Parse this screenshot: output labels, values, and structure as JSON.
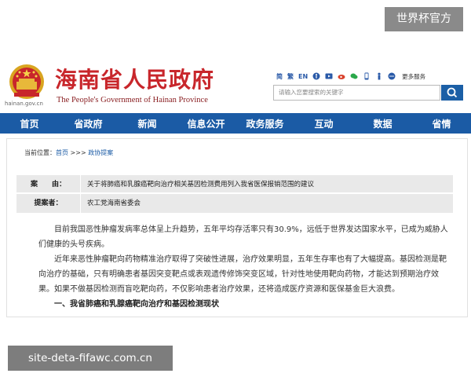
{
  "watermark_top": "世界杯官方",
  "watermark_bottom": "site-deta-fifawc.com.cn",
  "header": {
    "domain": "hainan.gov.cn",
    "title_cn": "海南省人民政府",
    "title_en": "The People's Government of Hainan Province",
    "toolbar": {
      "items": [
        "简",
        "繁",
        "EN"
      ],
      "more": "更多服务"
    },
    "search_placeholder": "请输入您要搜索的关键字"
  },
  "nav": {
    "items": [
      "首页",
      "省政府",
      "新闻",
      "信息公开",
      "政务服务",
      "互动",
      "数据",
      "省情"
    ]
  },
  "breadcrumb": {
    "prefix": "当前位置：",
    "home": "首页",
    "sep": " >>> ",
    "current": "政协提案"
  },
  "proposal": {
    "subject_label": "案　　由：",
    "subject": "关于将肺癌和乳腺癌靶向治疗相关基因检测费用列入我省医保报销范围的建议",
    "proposer_label": "提案者：",
    "proposer": "农工党海南省委会"
  },
  "body": {
    "paragraphs": [
      "目前我国恶性肿瘤发病率总体呈上升趋势，五年平均存活率只有30.9%，远低于世界发达国家水平，已成为威胁人们健康的头号疾病。",
      "近年来恶性肿瘤靶向药物精准治疗取得了突破性进展，治疗效果明显，五年生存率也有了大幅提高。基因检测是靶向治疗的基础，只有明确患者基因突变靶点或表观遗传修饰突变区域，针对性地使用靶向药物，才能达到预期治疗效果。如果不做基因检测而盲吃靶向药，不仅影响患者治疗效果，还将造成医疗资源和医保基金巨大浪费。"
    ],
    "heading": "一、我省肺癌和乳腺癌靶向治疗和基因检测现状"
  }
}
